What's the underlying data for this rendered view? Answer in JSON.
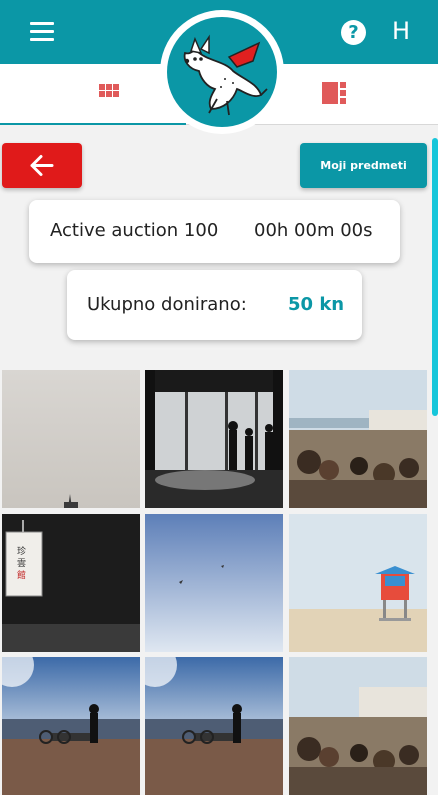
{
  "header": {
    "menu_icon": "hamburger-menu-icon",
    "help_icon": "question-circle-icon",
    "help_glyph": "?",
    "user_initial": "H",
    "color": "#0b97a6"
  },
  "tabs": {
    "grid_icon": "grid-view-icon",
    "list_icon": "list-view-icon",
    "accent_color": "#e05a5a"
  },
  "logo": {
    "icon": "flying-dog-mascot-logo"
  },
  "actions": {
    "back_icon": "arrow-left-icon",
    "back_color": "#e01a1a",
    "my_items_label": "Moji predmeti"
  },
  "auction": {
    "label": "Active auction 100",
    "timer": "00h 00m 00s"
  },
  "donation": {
    "label": "Ukupno donirano:",
    "value": "50 kn"
  },
  "gallery": {
    "photos": [
      {
        "subject": "hazy sky with spire"
      },
      {
        "subject": "silhouettes at panoramic window"
      },
      {
        "subject": "crowd at seaside viewpoint"
      },
      {
        "subject": "hanging paper lantern"
      },
      {
        "subject": "birds in clear blue sky"
      },
      {
        "subject": "lifeguard tower on beach"
      },
      {
        "subject": "person with bicycle at sunset shore"
      },
      {
        "subject": "person with bicycle at sunset shore"
      },
      {
        "subject": "crowd at seaside viewpoint"
      }
    ]
  }
}
